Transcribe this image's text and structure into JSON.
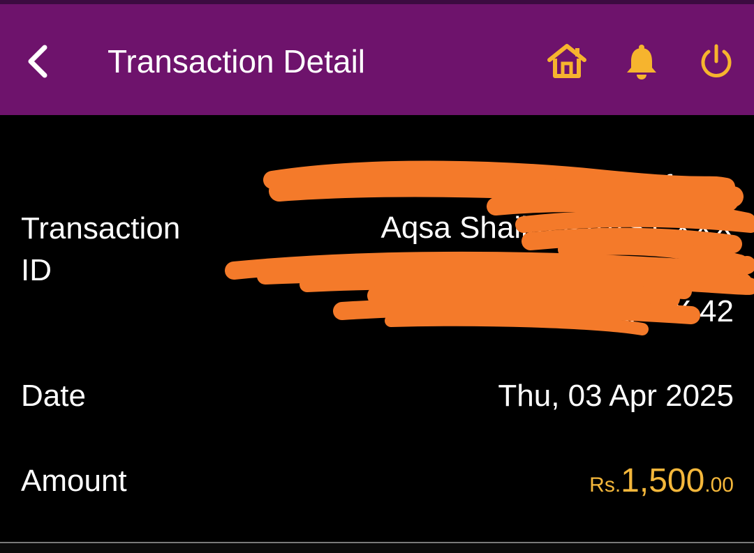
{
  "header": {
    "title": "Transaction Detail",
    "back_icon": "chevron-left-icon",
    "home_icon": "home-icon",
    "notification_icon": "bell-icon",
    "power_icon": "power-icon"
  },
  "colors": {
    "header_bg": "#6e136c",
    "icon_accent": "#f6b42e",
    "amount_accent": "#f4b73b",
    "background": "#000000",
    "redaction": "#f47a2a"
  },
  "details": {
    "transaction_id": {
      "label_line1": "Transaction",
      "label_line2": "ID",
      "value_lines": [
        "Raast P2P Fund Transfer to",
        "Aqsa Shaikh RAAST XXX",
        "XXXX XXXX XXXX XXXX 5",
        "04 0 XXXX 42"
      ]
    },
    "date": {
      "label": "Date",
      "value": "Thu, 03 Apr 2025"
    },
    "amount": {
      "label": "Amount",
      "currency": "Rs.",
      "major": "1,500",
      "minor": ".00"
    }
  }
}
